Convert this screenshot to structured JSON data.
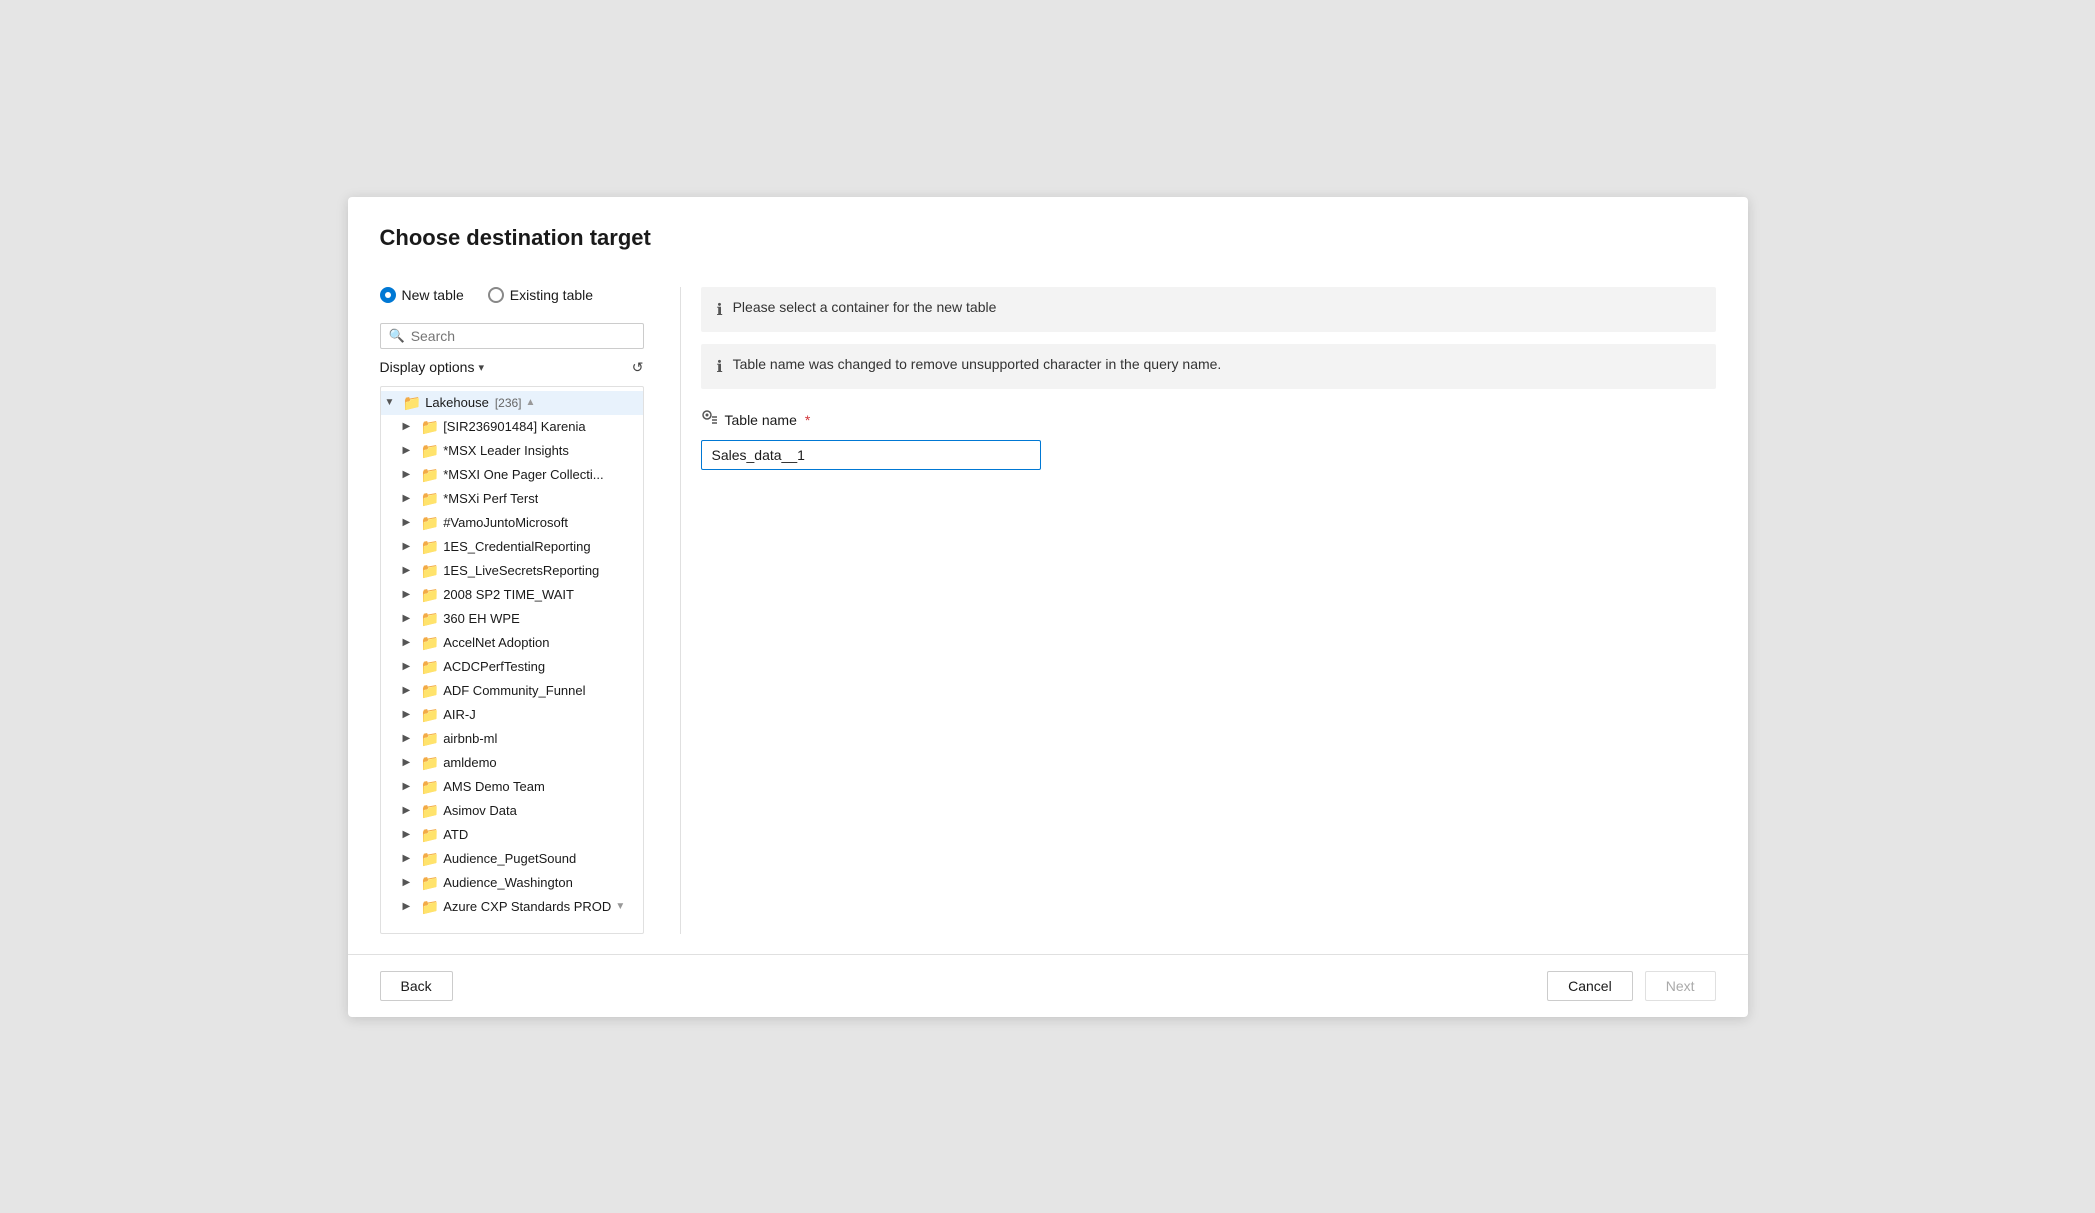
{
  "dialog": {
    "title": "Choose destination target"
  },
  "radio_group": {
    "options": [
      {
        "id": "new-table",
        "label": "New table",
        "selected": true
      },
      {
        "id": "existing-table",
        "label": "Existing table",
        "selected": false
      }
    ]
  },
  "search": {
    "placeholder": "Search",
    "value": ""
  },
  "display_options": {
    "label": "Display options",
    "chevron": "▾"
  },
  "banners": {
    "info": "Please select a container for the new table",
    "warning": "Table name was changed to remove unsupported character in the query name."
  },
  "table_name": {
    "label": "Table name",
    "required": true,
    "value": "Sales_data__1",
    "icon": "🔤"
  },
  "tree": {
    "root": {
      "label": "Lakehouse",
      "count": "[236]",
      "expanded": true
    },
    "items": [
      {
        "label": "[SIR236901484] Karenia",
        "indent": 1
      },
      {
        "label": "*MSX Leader Insights",
        "indent": 1
      },
      {
        "label": "*MSXI One Pager Collecti...",
        "indent": 1
      },
      {
        "label": "*MSXi Perf Terst",
        "indent": 1
      },
      {
        "label": "#VamoJuntoMicrosoft",
        "indent": 1
      },
      {
        "label": "1ES_CredentialReporting",
        "indent": 1
      },
      {
        "label": "1ES_LiveSecretsReporting",
        "indent": 1
      },
      {
        "label": "2008 SP2 TIME_WAIT",
        "indent": 1
      },
      {
        "label": "360 EH WPE",
        "indent": 1
      },
      {
        "label": "AccelNet Adoption",
        "indent": 1
      },
      {
        "label": "ACDCPerfTesting",
        "indent": 1
      },
      {
        "label": "ADF Community_Funnel",
        "indent": 1
      },
      {
        "label": "AIR-J",
        "indent": 1
      },
      {
        "label": "airbnb-ml",
        "indent": 1
      },
      {
        "label": "amldemo",
        "indent": 1
      },
      {
        "label": "AMS Demo Team",
        "indent": 1
      },
      {
        "label": "Asimov Data",
        "indent": 1
      },
      {
        "label": "ATD",
        "indent": 1
      },
      {
        "label": "Audience_PugetSound",
        "indent": 1
      },
      {
        "label": "Audience_Washington",
        "indent": 1
      },
      {
        "label": "Azure CXP Standards PROD",
        "indent": 1
      }
    ]
  },
  "footer": {
    "back_label": "Back",
    "cancel_label": "Cancel",
    "next_label": "Next"
  }
}
